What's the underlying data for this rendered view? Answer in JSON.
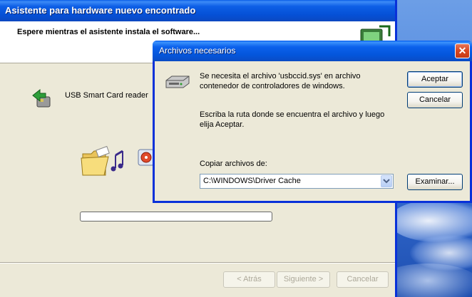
{
  "wizard": {
    "title": "Asistente para hardware nuevo encontrado",
    "header_text": "Espere mientras el asistente instala el software...",
    "device_label": "USB Smart Card reader",
    "progress": 0,
    "buttons": {
      "back": "< Atrás",
      "next": "Siguiente >",
      "cancel": "Cancelar"
    }
  },
  "dialog": {
    "title": "Archivos necesarios",
    "close_label": "✕",
    "message1": "Se necesita el archivo 'usbccid.sys' en archivo contenedor de controladores de windows.",
    "message2": "Escriba la ruta donde se encuentra el archivo y luego elija Aceptar.",
    "copy_label": "Copiar archivos de:",
    "copy_value": "C:\\WINDOWS\\Driver Cache",
    "buttons": {
      "accept": "Aceptar",
      "cancel": "Cancelar",
      "browse": "Examinar..."
    }
  },
  "colors": {
    "titlebar_blue": "#0550d6",
    "window_face": "#ece9d8",
    "close_red": "#d8461f"
  },
  "icons": [
    "hardware-wizard-icon",
    "smart-card-device-icon",
    "folder-icon",
    "music-notes-icon",
    "media-icon",
    "disk-drive-icon",
    "close-icon",
    "chevron-down-icon"
  ]
}
